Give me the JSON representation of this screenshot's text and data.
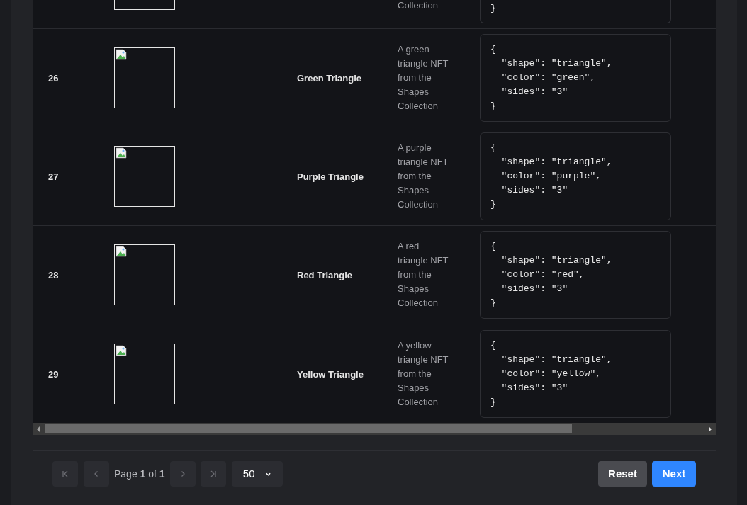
{
  "table": {
    "rows": [
      {
        "kind": "partial",
        "description": "Collection",
        "metadata": "}"
      },
      {
        "kind": "full",
        "number": "26",
        "name": "Green Triangle",
        "description": "A green triangle NFT from the Shapes Collection",
        "metadata": "{\n  \"shape\": \"triangle\",\n  \"color\": \"green\",\n  \"sides\": \"3\"\n}"
      },
      {
        "kind": "full",
        "number": "27",
        "name": "Purple Triangle",
        "description": "A purple triangle NFT from the Shapes Collection",
        "metadata": "{\n  \"shape\": \"triangle\",\n  \"color\": \"purple\",\n  \"sides\": \"3\"\n}"
      },
      {
        "kind": "full",
        "number": "28",
        "name": "Red Triangle",
        "description": "A red triangle NFT from the Shapes Collection",
        "metadata": "{\n  \"shape\": \"triangle\",\n  \"color\": \"red\",\n  \"sides\": \"3\"\n}"
      },
      {
        "kind": "full",
        "number": "29",
        "name": "Yellow Triangle",
        "description": "A yellow triangle NFT from the Shapes Collection",
        "metadata": "{\n  \"shape\": \"triangle\",\n  \"color\": \"yellow\",\n  \"sides\": \"3\"\n}"
      }
    ]
  },
  "pagination": {
    "page_text": "Page **1** of **1**",
    "page_size": "50",
    "reset": "Reset",
    "next": "Next"
  }
}
